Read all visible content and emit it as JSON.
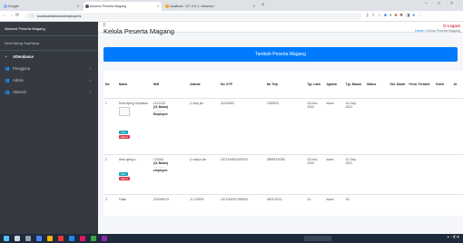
{
  "browser": {
    "tabs": [
      {
        "label": "Google",
        "active": false
      },
      {
        "label": "Absensi Peserta Magang",
        "active": true
      },
      {
        "label": "localhost / 127.0.0.1 / absensi /",
        "active": false
      }
    ],
    "new_tab": "+",
    "url": "localhost/absensi/employees",
    "window_controls": [
      "–",
      "□",
      "×"
    ]
  },
  "sidebar": {
    "brand": "Absensi Peserta Magang",
    "user": "Dewi Ajeng Sophiana",
    "items": [
      {
        "label": "Attendance",
        "icon": "clock-icon",
        "arrow": ""
      },
      {
        "label": "Pengguna",
        "icon": "users-icon",
        "arrow": "‹"
      },
      {
        "label": "Admin",
        "icon": "users-icon",
        "arrow": "‹"
      },
      {
        "label": "Absensi",
        "icon": "users-icon",
        "arrow": "‹"
      }
    ]
  },
  "topnav": {
    "menu_icon": "≡",
    "logout_label": "Logout"
  },
  "page": {
    "title": "Kelola Peserta Magang",
    "breadcrumb_home": "Home",
    "breadcrumb_sep": "/",
    "breadcrumb_current": "Kelola Peserta Magang",
    "add_button": "Tambah Peserta Magang"
  },
  "table": {
    "headers": [
      "No",
      "Nama",
      "NIM",
      "Alamat",
      "No. KTP",
      "No Telp",
      "Tgl. Lahir",
      "Agama",
      "Tgl. Masuk",
      "Status",
      "Gol. Darah",
      "Pend. Terakhir",
      "Divisi",
      "Ja"
    ],
    "rows": [
      {
        "no": "1",
        "nama": "Dewi Ajeng Sophiana",
        "nim": "1212133",
        "durasi": "(11 Bulan)",
        "role": "Employee",
        "alamat": "jl. May jen",
        "ktp": "32432352",
        "telp": "2352523",
        "lahir": "03-Nov-2000",
        "agama": "Islam",
        "masuk": "01-Sep-2021",
        "btn_view": "View",
        "btn_hapus": "Hapus"
      },
      {
        "no": "2",
        "nama": "dewi ajeng s",
        "nim": "123240",
        "durasi": "(11 Bulan)",
        "role": "employee",
        "alamat": "jl. mayor jen",
        "ktp": "1671104511000003",
        "telp": "089933193M",
        "lahir": "03-Nov-2000",
        "agama": "Islam",
        "masuk": "01-Sep-2021",
        "btn_view": "View",
        "btn_hapus": "Hapus"
      },
      {
        "no": "3",
        "nama": "Falah",
        "nim": "202009013",
        "durasi": "",
        "role": "",
        "alamat": "Jl. LRDPA",
        "ktp": "1671062207990000",
        "telp": "0878-9223-",
        "lahir": "22-",
        "agama": "Islam",
        "masuk": "29-",
        "btn_view": "",
        "btn_hapus": ""
      }
    ]
  },
  "colors": {
    "primary": "#007bff",
    "sidebar": "#343a40",
    "danger": "#dc3545",
    "info": "#17a2b8"
  }
}
